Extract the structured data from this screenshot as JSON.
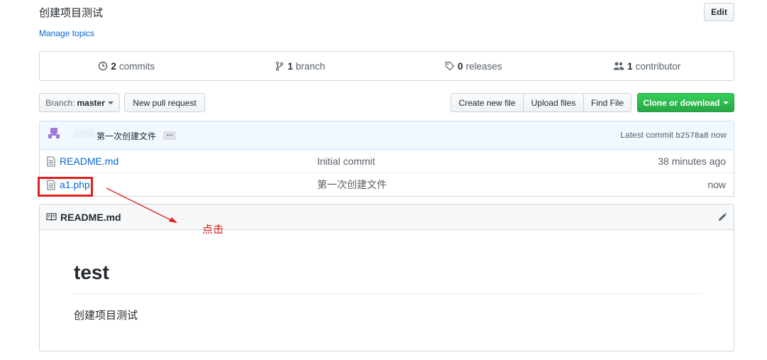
{
  "repo": {
    "description": "创建项目测试",
    "manage_topics": "Manage topics",
    "edit_label": "Edit"
  },
  "summary": {
    "commits_count": "2",
    "commits_label": "commits",
    "branches_count": "1",
    "branches_label": "branch",
    "releases_count": "0",
    "releases_label": "releases",
    "contributors_count": "1",
    "contributors_label": "contributor"
  },
  "toolbar": {
    "branch_prefix": "Branch:",
    "branch_name": "master",
    "new_pr": "New pull request",
    "create_file": "Create new file",
    "upload_files": "Upload files",
    "find_file": "Find File",
    "clone": "Clone or download"
  },
  "commit": {
    "message": "第一次创建文件",
    "ellipsis": "…",
    "latest_label": "Latest commit",
    "sha": "b2578a8",
    "time": "now"
  },
  "files": [
    {
      "name": "README.md",
      "message": "Initial commit",
      "age": "38 minutes ago"
    },
    {
      "name": "a1.php",
      "message": "第一次创建文件",
      "age": "now"
    }
  ],
  "readme": {
    "header": "README.md",
    "heading": "test",
    "body": "创建项目测试"
  },
  "annotation": {
    "text": "点击",
    "color": "#e0201e"
  },
  "colors": {
    "link": "#0366d6",
    "clone_green": "#28a745",
    "commit_bar": "#f1f8ff"
  }
}
